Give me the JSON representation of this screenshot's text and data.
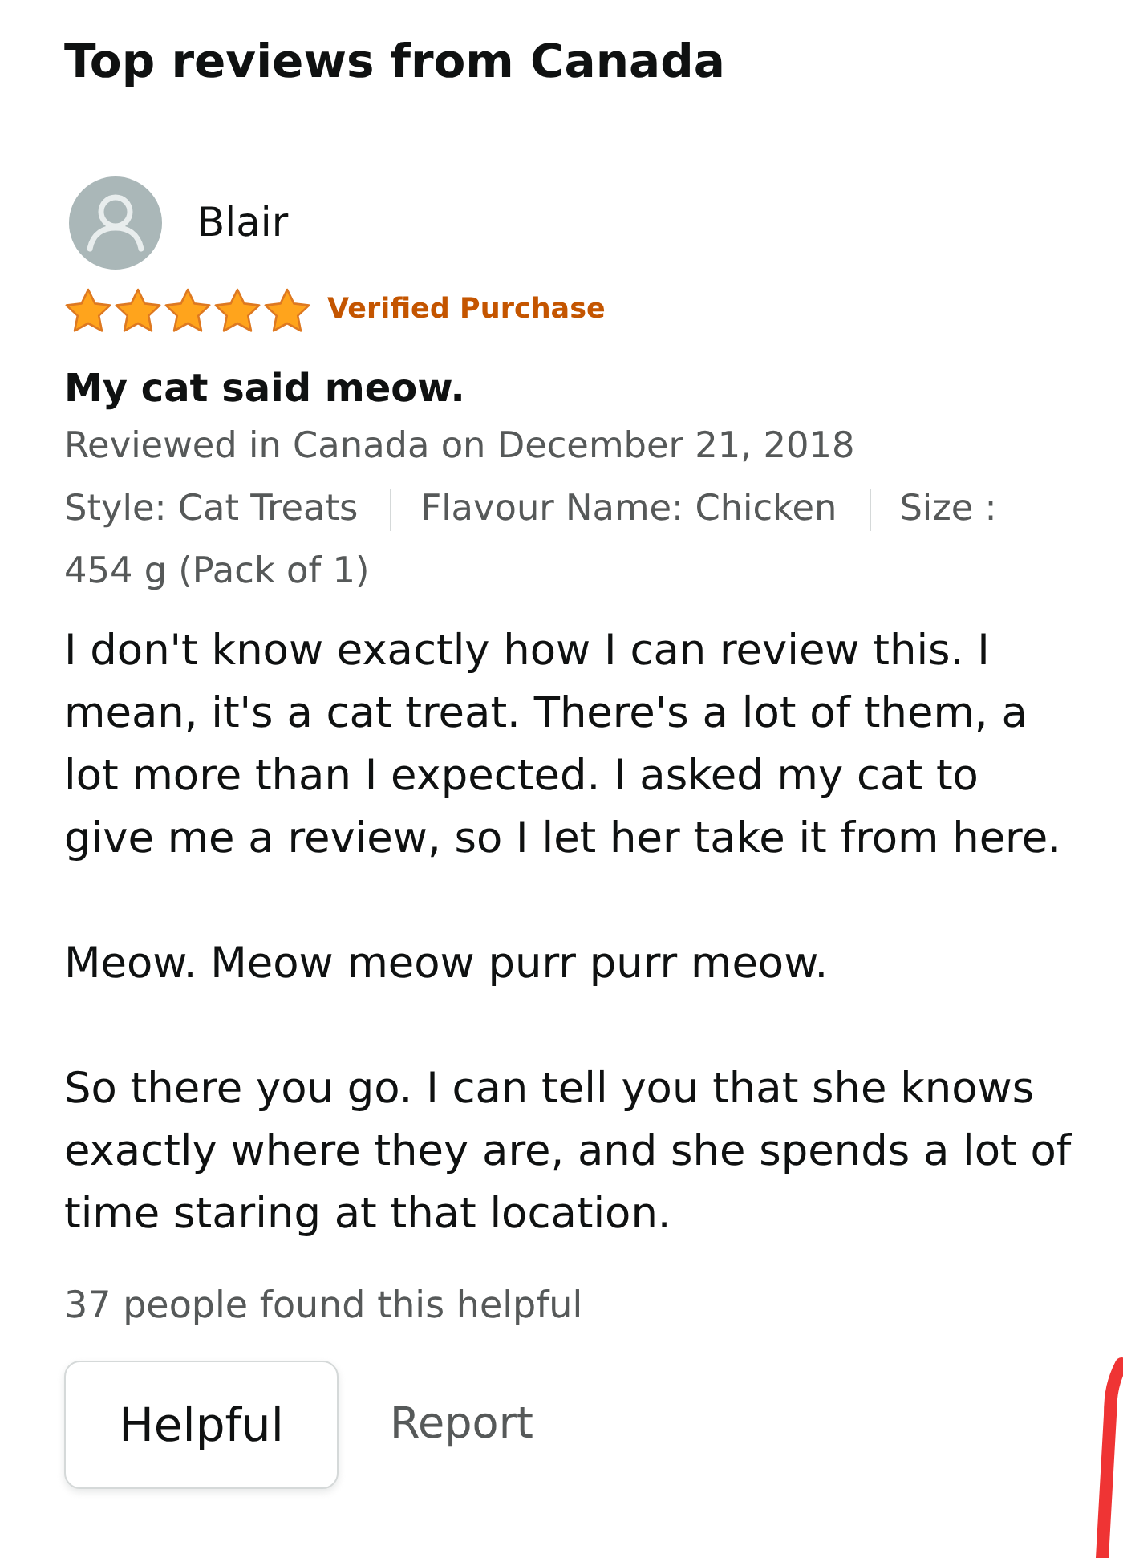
{
  "section": {
    "title": "Top reviews from Canada"
  },
  "review": {
    "reviewer": {
      "name": "Blair"
    },
    "stars": 5,
    "badge": "Verified Purchase",
    "title": "My cat said meow.",
    "date_line": "Reviewed in Canada on December 21, 2018",
    "variations": [
      "Style: Cat Treats",
      "Flavour Name: Chicken",
      "Size : 454 g (Pack of 1)"
    ],
    "body": [
      "I don't know exactly how I can review this. I mean, it's a cat treat. There's a lot of them, a lot more than I expected. I asked my cat to give me a review, so I let her take it from here.",
      "Meow. Meow meow purr purr meow.",
      "So there you go. I can tell you that she knows exactly where they are, and she spends a lot of time staring at that location."
    ],
    "helpful_count": "37 people found this helpful",
    "actions": [
      {
        "label": "Helpful",
        "kind": "button"
      },
      {
        "label": "Report",
        "kind": "link"
      }
    ]
  }
}
